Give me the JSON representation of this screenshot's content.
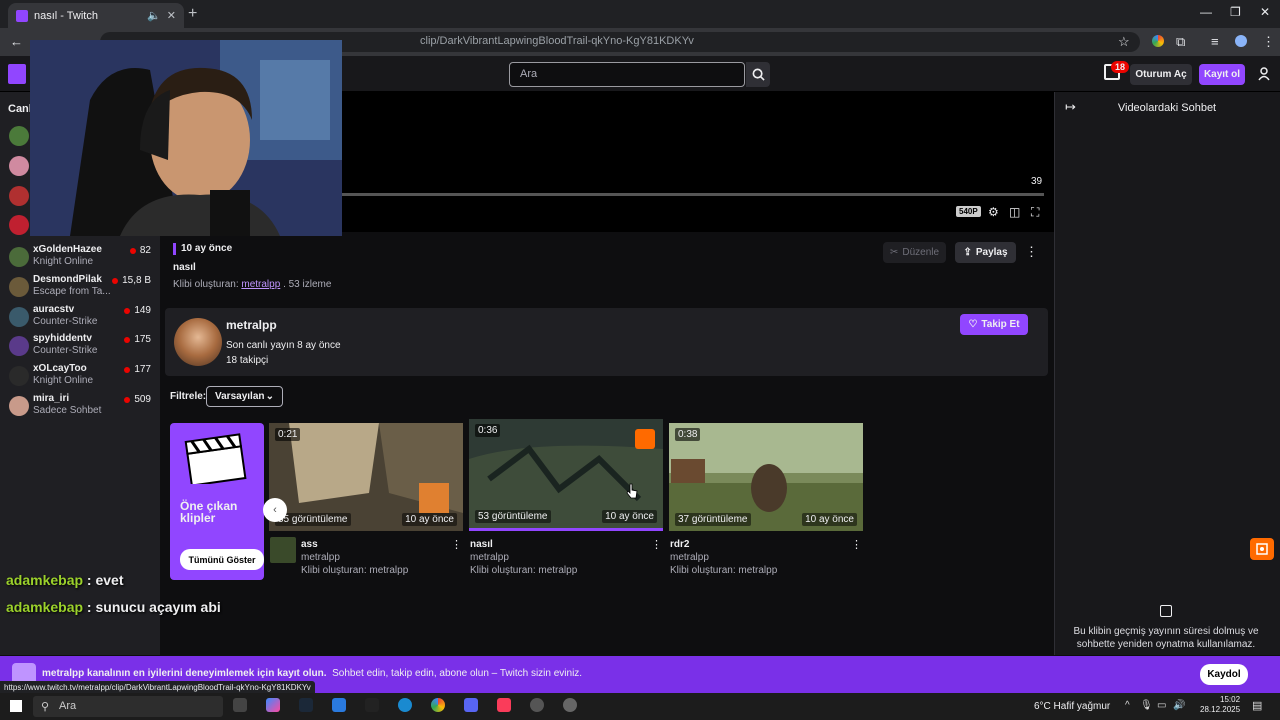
{
  "browser": {
    "tab_title": "nasıl - Twitch",
    "url": "clip/DarkVibrantLapwingBloodTrail-qkYno-KgY81KDKYv",
    "status_url": "https://www.twitch.tv/metralpp/clip/DarkVibrantLapwingBloodTrail-qkYno-KgY81KDKYv"
  },
  "topnav": {
    "search_placeholder": "Ara",
    "notif_count": "18",
    "login_label": "Oturum Aç",
    "signup_label": "Kayıt ol"
  },
  "sidebar": {
    "title": "Canlı",
    "items": [
      {
        "name": "xGoldenHazee",
        "game": "Knight Online",
        "viewers": "82",
        "color": "#4b6b3a"
      },
      {
        "name": "DesmondPilak",
        "game": "Escape from Ta...",
        "viewers": "15,8 B",
        "color": "#6b5a3a"
      },
      {
        "name": "auracstv",
        "game": "Counter-Strike",
        "viewers": "149",
        "color": "#3a5a6b"
      },
      {
        "name": "spyhiddentv",
        "game": "Counter-Strike",
        "viewers": "175",
        "color": "#5a3a8a"
      },
      {
        "name": "xOLcayToo",
        "game": "Knight Online",
        "viewers": "177",
        "color": "#2a2a2a"
      },
      {
        "name": "mira_iri",
        "game": "Sadece Sohbet",
        "viewers": "509",
        "color": "#c89a8a"
      }
    ]
  },
  "player": {
    "time": "39",
    "quality": "540P",
    "progress": 0.3
  },
  "clip": {
    "ago": "10 ay önce",
    "title": "nasıl",
    "created_by": "Klibi oluşturan:",
    "creator": "metralpp",
    "views": ". 53 izleme",
    "edit_label": "Düzenle",
    "share_label": "Paylaş"
  },
  "channel": {
    "name": "metralpp",
    "last_live": "Son canlı yayın 8 ay önce",
    "followers": "18 takipçi",
    "follow_label": "Takip Et"
  },
  "filter": {
    "label": "Filtrele:",
    "value": "Varsayılan"
  },
  "featured": {
    "title": "Öne çıkan klipler",
    "show_all": "Tümünü Göster"
  },
  "clips": [
    {
      "duration": "0:21",
      "views": "55 görüntüleme",
      "ago": "10 ay önce",
      "title": "ass",
      "channel": "metralpp",
      "by": "Klibi oluşturan: metralpp"
    },
    {
      "duration": "0:36",
      "views": "53 görüntüleme",
      "ago": "10 ay önce",
      "title": "nasıl",
      "channel": "metralpp",
      "by": "Klibi oluşturan: metralpp"
    },
    {
      "duration": "0:38",
      "views": "37 görüntüleme",
      "ago": "10 ay önce",
      "title": "rdr2",
      "channel": "metralpp",
      "by": "Klibi oluşturan: metralpp"
    }
  ],
  "chat_panel": {
    "title": "Videolardaki Sohbet",
    "message": "Bu klibin geçmiş yayının süresi dolmuş ve sohbette yeniden oynatma kullanılamaz."
  },
  "overlay_chat": [
    {
      "user": "adamkebap",
      "text": " : evet"
    },
    {
      "user": "adamkebap",
      "text": " : sunucu açayım abi"
    }
  ],
  "banner": {
    "bold": "metralpp kanalının en iyilerini deneyimlemek için kayıt olun.",
    "text": "Sohbet edin, takip edin, abone olun – Twitch sizin eviniz.",
    "button": "Kaydol"
  },
  "taskbar": {
    "search": "Ara",
    "weather": "6°C  Hafif yağmur",
    "time": "15:02",
    "date": "28.12.2025"
  }
}
